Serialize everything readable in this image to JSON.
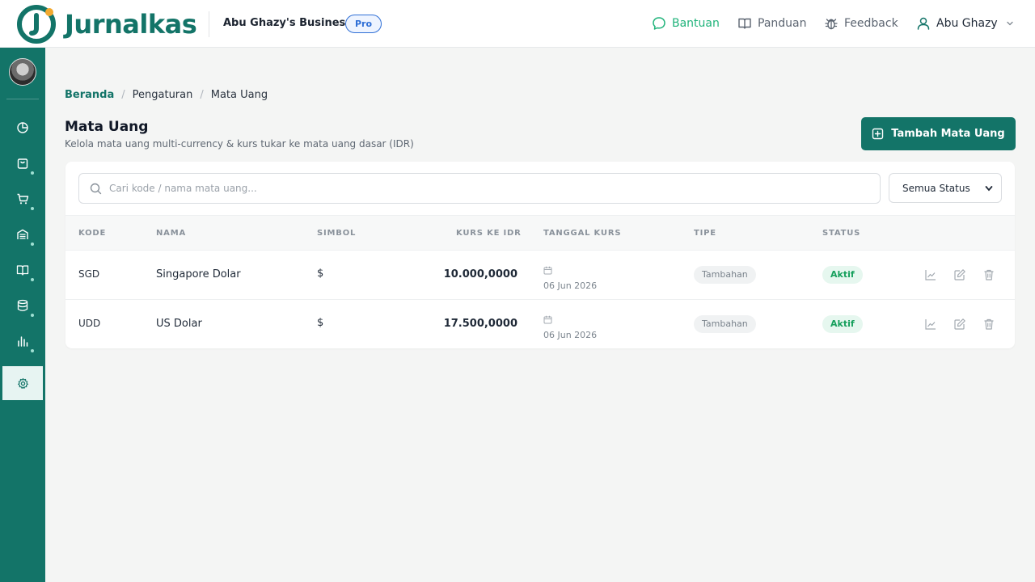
{
  "header": {
    "brand": "Jurnalkas",
    "business_name": "Abu Ghazy's Business",
    "plan_badge": "Pro",
    "nav": {
      "help": "Bantuan",
      "guide": "Panduan",
      "feedback": "Feedback",
      "user": "Abu Ghazy"
    }
  },
  "breadcrumb": [
    "Beranda",
    "Pengaturan",
    "Mata Uang"
  ],
  "breadcrumb_sep": "/",
  "page": {
    "title": "Mata Uang",
    "subtitle": "Kelola mata uang multi-currency & kurs tukar ke mata uang dasar (IDR)",
    "add_button": "Tambah Mata Uang"
  },
  "filters": {
    "search_placeholder": "Cari kode / nama mata uang...",
    "status_selected": "Semua Status"
  },
  "table": {
    "columns": [
      "KODE",
      "NAMA",
      "SIMBOL",
      "KURS KE IDR",
      "TANGGAL KURS",
      "TIPE",
      "STATUS"
    ],
    "rows": [
      {
        "code": "SGD",
        "name": "Singapore Dolar",
        "symbol": "$",
        "rate": "10.000,0000",
        "date": "06 Jun 2026",
        "type": "Tambahan",
        "status": "Aktif"
      },
      {
        "code": "UDD",
        "name": "US Dolar",
        "symbol": "$",
        "rate": "17.500,0000",
        "date": "06 Jun 2026",
        "type": "Tambahan",
        "status": "Aktif"
      }
    ]
  },
  "colors": {
    "brand": "#137468",
    "accent_green": "#1fb37a",
    "pro_blue": "#2f6fd6",
    "status_active": "#17a05d"
  },
  "sidebar_icons": [
    "dashboard-icon",
    "sales-icon",
    "purchase-icon",
    "inventory-icon",
    "ledger-icon",
    "database-icon",
    "reports-icon",
    "settings-icon"
  ]
}
